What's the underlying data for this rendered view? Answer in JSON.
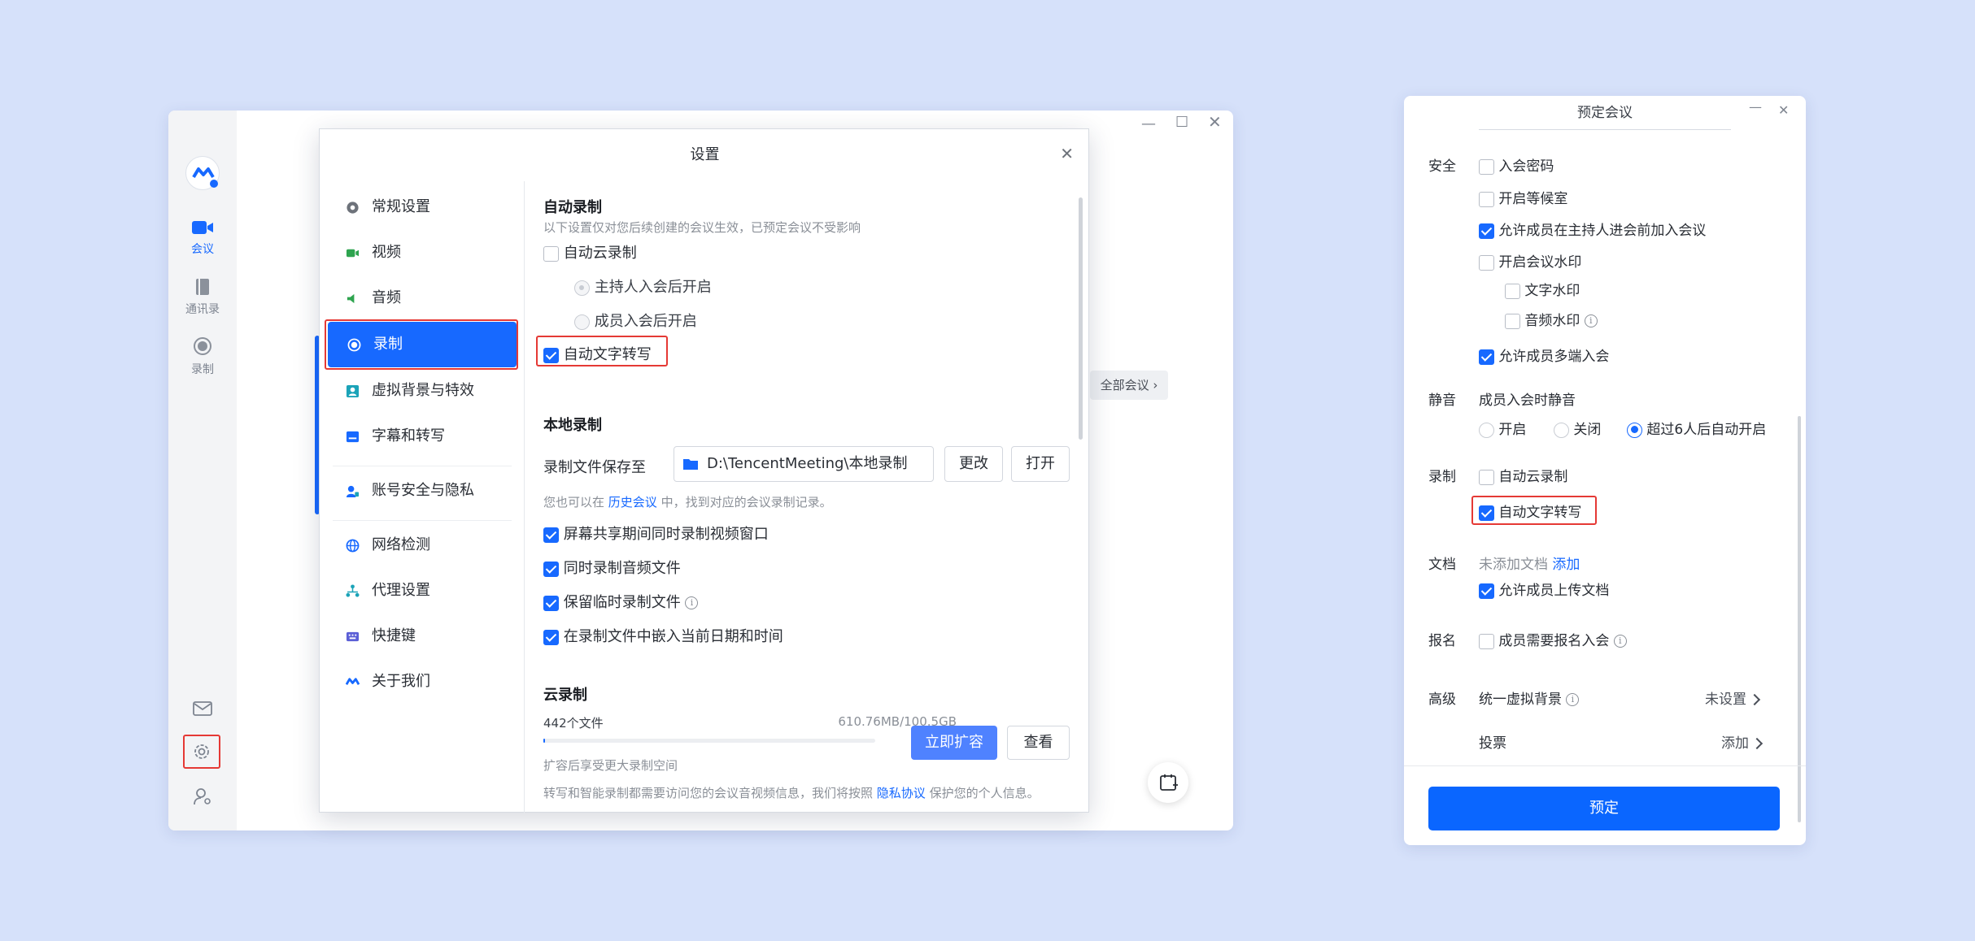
{
  "main_window": {
    "rail": {
      "logo_label": "腾讯会议",
      "items": [
        {
          "label": "会议",
          "icon": "video-camera-icon"
        },
        {
          "label": "通讯录",
          "icon": "contacts-icon"
        },
        {
          "label": "录制",
          "icon": "record-icon"
        }
      ],
      "bottom_icons": [
        "mail-icon",
        "gear-icon",
        "user-settings-icon"
      ]
    },
    "window_controls": [
      "minimize",
      "maximize",
      "close"
    ],
    "background_link": "全部会议",
    "calendar_icon": "calendar-add-icon"
  },
  "settings": {
    "title": "设置",
    "nav": [
      {
        "label": "常规设置",
        "icon": "gear-icon"
      },
      {
        "label": "视频",
        "icon": "video-icon"
      },
      {
        "label": "音频",
        "icon": "audio-icon"
      },
      {
        "label": "录制",
        "icon": "record-icon"
      },
      {
        "label": "虚拟背景与特效",
        "icon": "virtual-bg-icon"
      },
      {
        "label": "字幕和转写",
        "icon": "subtitle-icon"
      },
      {
        "label": "账号安全与隐私",
        "icon": "account-security-icon"
      },
      {
        "label": "网络检测",
        "icon": "network-icon"
      },
      {
        "label": "代理设置",
        "icon": "proxy-icon"
      },
      {
        "label": "快捷键",
        "icon": "keyboard-icon"
      },
      {
        "label": "关于我们",
        "icon": "about-icon"
      }
    ],
    "auto_record": {
      "heading": "自动录制",
      "note": "以下设置仅对您后续创建的会议生效，已预定会议不受影响",
      "cloud_label": "自动云录制",
      "cloud_checked": false,
      "radio_host": "主持人入会后开启",
      "radio_member": "成员入会后开启",
      "transcribe_label": "自动文字转写",
      "transcribe_checked": true
    },
    "local_record": {
      "heading": "本地录制",
      "save_to_label": "录制文件保存至",
      "path": "D:\\TencentMeeting\\本地录制",
      "change_btn": "更改",
      "open_btn": "打开",
      "hint_prefix": "您也可以在",
      "hint_link": "历史会议",
      "hint_suffix": "中，找到对应的会议录制记录。",
      "options": [
        {
          "label": "屏幕共享期间同时录制视频窗口",
          "checked": true
        },
        {
          "label": "同时录制音频文件",
          "checked": true
        },
        {
          "label": "保留临时录制文件",
          "checked": true,
          "info": true
        },
        {
          "label": "在录制文件中嵌入当前日期和时间",
          "checked": true
        }
      ]
    },
    "cloud_record": {
      "heading": "云录制",
      "files": "442个文件",
      "usage": "610.76MB/100.5GB",
      "usage_fraction": 0.006,
      "expand_btn": "立即扩容",
      "view_btn": "查看",
      "expand_hint": "扩容后享受更大录制空间",
      "privacy_prefix": "转写和智能录制都需要访问您的会议音视频信息，我们将按照",
      "privacy_link": "隐私协议",
      "privacy_suffix": "保护您的个人信息。"
    }
  },
  "schedule": {
    "title": "预定会议",
    "security": {
      "label": "安全",
      "options": [
        {
          "label": "入会密码",
          "checked": false
        },
        {
          "label": "开启等候室",
          "checked": false
        },
        {
          "label": "允许成员在主持人进会前加入会议",
          "checked": true
        },
        {
          "label": "开启会议水印",
          "checked": false
        }
      ],
      "watermark_sub": [
        {
          "label": "文字水印",
          "checked": false
        },
        {
          "label": "音频水印",
          "checked": false,
          "info": true
        }
      ],
      "multi_device": {
        "label": "允许成员多端入会",
        "checked": true
      }
    },
    "mute": {
      "label": "静音",
      "desc": "成员入会时静音",
      "options": [
        {
          "label": "开启",
          "selected": false
        },
        {
          "label": "关闭",
          "selected": false
        },
        {
          "label": "超过6人后自动开启",
          "selected": true
        }
      ]
    },
    "record": {
      "label": "录制",
      "cloud": {
        "label": "自动云录制",
        "checked": false
      },
      "transcribe": {
        "label": "自动文字转写",
        "checked": true
      }
    },
    "docs": {
      "label": "文档",
      "none_text": "未添加文档",
      "add_link": "添加",
      "allow_upload": {
        "label": "允许成员上传文档",
        "checked": true
      }
    },
    "signup": {
      "label": "报名",
      "option": "成员需要报名入会",
      "checked": false
    },
    "advanced": {
      "label": "高级",
      "bg_label": "统一虚拟背景",
      "bg_value": "未设置",
      "vote_label": "投票",
      "vote_value": "添加"
    },
    "submit": "预定"
  },
  "colors": {
    "accent": "#1769ff",
    "highlight": "#e53935",
    "background": "#d6e1fa"
  }
}
